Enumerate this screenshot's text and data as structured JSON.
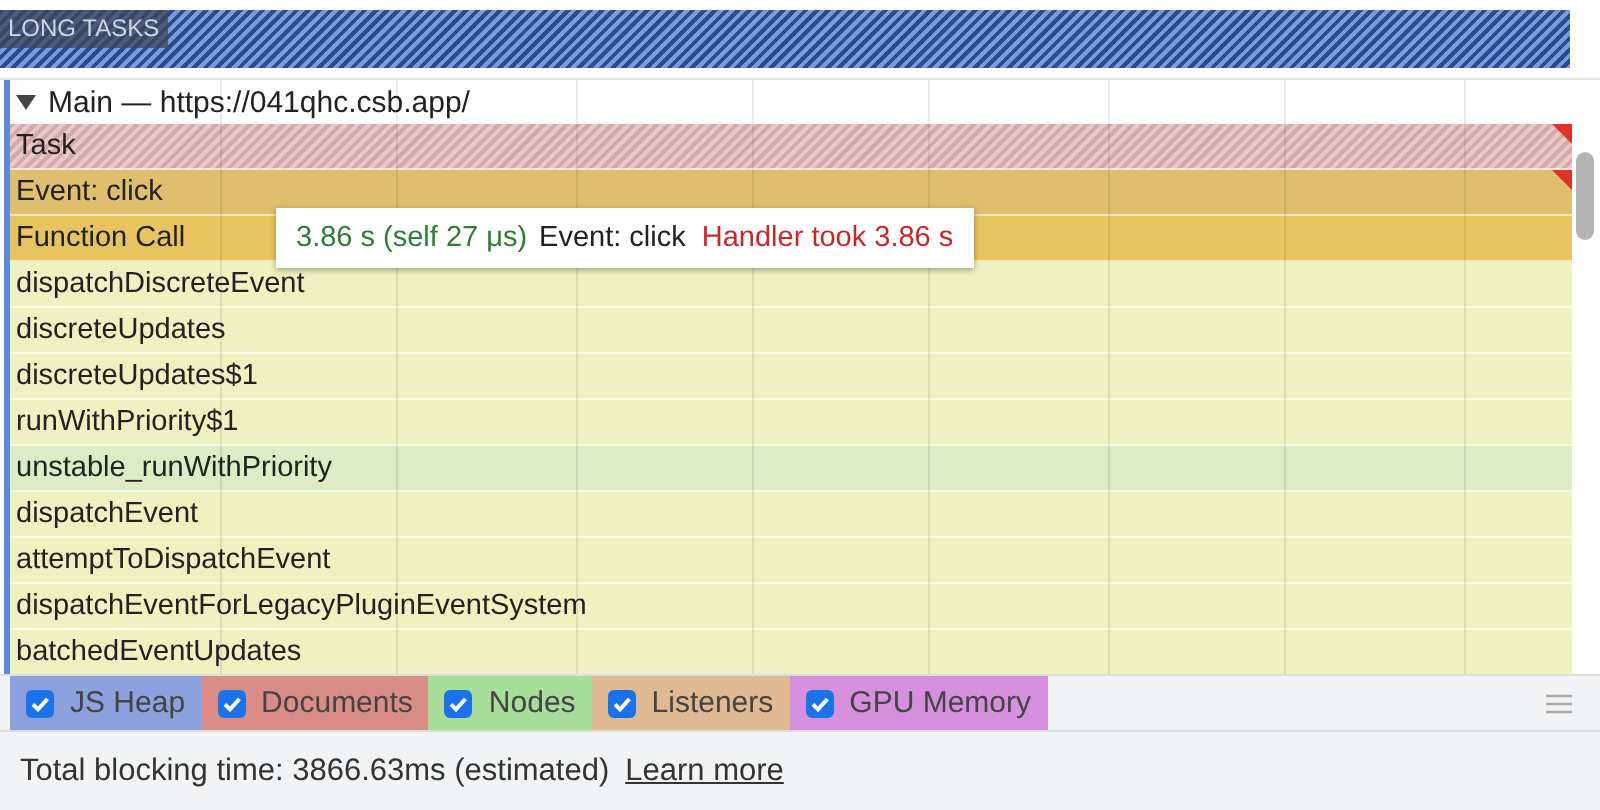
{
  "long_tasks": {
    "label": "LONG TASKS"
  },
  "track": {
    "title": "Main — https://041qhc.csb.app/",
    "expanded": true,
    "rows": [
      {
        "name": "Task",
        "kind": "task",
        "long": true
      },
      {
        "name": "Event: click",
        "kind": "event",
        "long": true
      },
      {
        "name": "Function Call",
        "kind": "function",
        "long": false
      },
      {
        "name": "dispatchDiscreteEvent",
        "kind": "script",
        "long": false
      },
      {
        "name": "discreteUpdates",
        "kind": "script",
        "long": false
      },
      {
        "name": "discreteUpdates$1",
        "kind": "script",
        "long": false
      },
      {
        "name": "runWithPriority$1",
        "kind": "script",
        "long": false
      },
      {
        "name": "unstable_runWithPriority",
        "kind": "scheduler",
        "long": false
      },
      {
        "name": "dispatchEvent",
        "kind": "script",
        "long": false
      },
      {
        "name": "attemptToDispatchEvent",
        "kind": "script",
        "long": false
      },
      {
        "name": "dispatchEventForLegacyPluginEventSystem",
        "kind": "script",
        "long": false
      },
      {
        "name": "batchedEventUpdates",
        "kind": "script",
        "long": false
      }
    ]
  },
  "tooltip": {
    "time": "3.86 s (self 27 μs)",
    "event": "Event: click",
    "warning": "Handler took 3.86 s"
  },
  "counters": [
    {
      "label": "JS Heap",
      "checked": true,
      "color": "#8ea1df"
    },
    {
      "label": "Documents",
      "checked": true,
      "color": "#da8d87"
    },
    {
      "label": "Nodes",
      "checked": true,
      "color": "#a6de9a"
    },
    {
      "label": "Listeners",
      "checked": true,
      "color": "#dfb991"
    },
    {
      "label": "GPU Memory",
      "checked": true,
      "color": "#d58fdd"
    }
  ],
  "footer": {
    "text": "Total blocking time: 3866.63ms (estimated)",
    "link": "Learn more"
  }
}
